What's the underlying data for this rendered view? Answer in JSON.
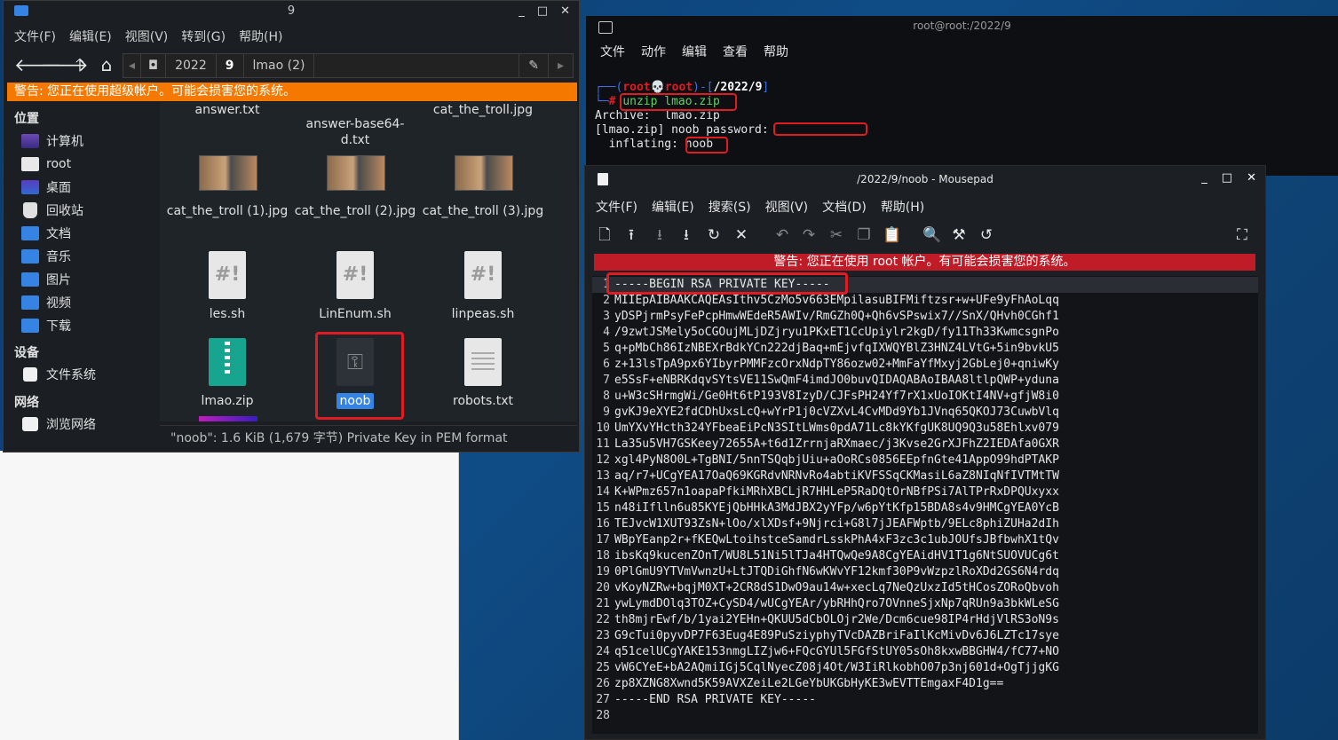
{
  "file_manager": {
    "title": "9",
    "window_controls": [
      "_",
      "□",
      "✕"
    ],
    "menu": [
      "文件(F)",
      "编辑(E)",
      "视图(V)",
      "转到(G)",
      "帮助(H)"
    ],
    "breadcrumbs": [
      "2022",
      "9",
      "lmao (2)"
    ],
    "warning": "警告: 您正在使用超级帐户。可能会损害您的系统。",
    "sidebar": {
      "places_heading": "位置",
      "places": [
        "计算机",
        "root",
        "桌面",
        "回收站",
        "文档",
        "音乐",
        "图片",
        "视频",
        "下载"
      ],
      "devices_heading": "设备",
      "devices": [
        "文件系统"
      ],
      "network_heading": "网络",
      "network": [
        "浏览网络"
      ]
    },
    "files": [
      {
        "name": "answer.txt"
      },
      {
        "name": "answer-base64-\nd.txt"
      },
      {
        "name": "cat_the_troll.jpg"
      },
      {
        "name": "cat_the_troll (1).jpg"
      },
      {
        "name": "cat_the_troll (2).jpg"
      },
      {
        "name": "cat_the_troll (3).jpg"
      },
      {
        "name": "les.sh"
      },
      {
        "name": "LinEnum.sh"
      },
      {
        "name": "linpeas.sh"
      },
      {
        "name": "lmao.zip"
      },
      {
        "name": "noob"
      },
      {
        "name": "robots.txt"
      }
    ],
    "status": "\"noob\": 1.6 KiB (1,679 字节) Private Key in PEM format"
  },
  "terminal": {
    "title": "root@root:/2022/9",
    "menu": [
      "文件",
      "动作",
      "编辑",
      "查看",
      "帮助"
    ],
    "prompt_user": "root",
    "prompt_skull": "💀",
    "prompt_host": "root",
    "prompt_path": "/2022/9",
    "command": "unzip lmao.zip",
    "lines": [
      "Archive:  lmao.zip",
      "[lmao.zip] noob password:"
    ],
    "inflating_prefix": "  inflating: ",
    "inflating_file": "noob"
  },
  "mousepad": {
    "title": "/2022/9/noob - Mousepad",
    "menu": [
      "文件(F)",
      "编辑(E)",
      "搜索(S)",
      "视图(V)",
      "文档(D)",
      "帮助(H)"
    ],
    "warning": "警告: 您正在使用 root 帐户。有可能会损害您的系统。",
    "lines": [
      "-----BEGIN RSA PRIVATE KEY-----",
      "MIIEpAIBAAKCAQEAsIthv5CzMo5v663EMpilasuBIFMiftzsr+w+UFe9yFhAoLqq",
      "yDSPjrmPsyFePcpHmwWEdeR5AWIv/RmGZh0Q+Qh6vSPswix7//SnX/QHvh0CGhf1",
      "/9zwtJSMely5oCGOujMLjDZjryu1PKxET1CcUpiylr2kgD/fy11Th33KwmcsgnPo",
      "q+pMbCh86IzNBEXrBdkYCn222djBaq+mEjvfqIXWQYBlZ3HNZ4LVtG+5in9bvkU5",
      "z+13lsTpA9px6YIbyrPMMFzcOrxNdpTY86ozw02+MmFaYfMxyj2GbLej0+qniwKy",
      "e5SsF+eNBRKdqvSYtsVE11SwQmF4imdJO0buvQIDAQABAoIBAA8ltlpQWP+yduna",
      "u+W3cSHrmgWi/Ge0Ht6tP193V8IzyD/CJFsPH24Yf7rX1xUoIOKtI4NV+gfjW8i0",
      "gvKJ9eXYE2fdCDhUxsLcQ+wYrP1j0cVZXvL4CvMDd9Yb1JVnq65QKOJ73CuwbVlq",
      "UmYXvYHcth324YFbeaEiPcN3SItLWms0pdA71Lc8kYKfgUK8UQ9Q3u58Ehlxv079",
      "La35u5VH7GSKeey72655A+t6d1ZrrnjaRXmaec/j3Kvse2GrXJFhZ2IEDAfa0GXR",
      "xgl4PyN8O0L+TgBNI/5nnTSQqbjUiu+aOoRCs0856EEpfnGte41AppO99hdPTAKP",
      "aq/r7+UCgYEA17OaQ69KGRdvNRNvRo4abtiKVFSSqCKMasiL6aZ8NIqNfIVTMtTW",
      "K+WPmz657n1oapaPfkiMRhXBCLjR7HHLeP5RaDQtOrNBfPSi7AlTPrRxDPQUxyxx",
      "n48iIflln6u85KYEjQbHHkA3MdJBX2yYFp/w6pYtKfp15BDA8s4v9HMCgYEA0YcB",
      "TEJvcW1XUT93ZsN+lOo/xlXDsf+9Njrci+G8l7jJEAFWptb/9ELc8phiZUHa2dIh",
      "WBpYEanp2r+fKEQwLtoihstceSamdrLsskPhA4xF3zc3c1ubJOUfsJBfbwhX1tQv",
      "ibsKq9kucenZOnT/WU8L51Ni5lTJa4HTQwQe9A8CgYEAidHV1T1g6NtSUOVUCg6t",
      "0PlGmU9YTVmVwnzU+LtJTQDiGhfN6wKWvYF12kmf30P9vWzpzlRoXDd2GS6N4rdq",
      "vKoyNZRw+bqjM0XT+2CR8dS1DwO9au14w+xecLq7NeQzUxzId5tHCosZORoQbvoh",
      "ywLymdDOlq3TOZ+CySD4/wUCgYEAr/ybRHhQro7OVnneSjxNp7qRUn9a3bkWLeSG",
      "th8mjrEwf/b/1yai2YEHn+QKUU5dCbOLOjr2We/Dcm6cue98IP4rHdjVlRS3oN9s",
      "G9cTui0pyvDP7F63Eug4E89PuSziyphyTVcDAZBriFaIlKcMivDv6J6LZTc17sye",
      "q51celUCgYAKE153nmgLIZjw6+FQcGYUl5FGfStUY05sOh8kxwBBGHW4/fC77+NO",
      "vW6CYeE+bA2AQmiIGj5CqlNyecZ08j4Ot/W3IiRlkobhO07p3nj601d+OgTjjgKG",
      "zp8XZNG8Xwnd5K59AVXZeiLe2LGeYbUKGbHyKE3wEVTTEmgaxF4D1g==",
      "-----END RSA PRIVATE KEY-----",
      ""
    ]
  },
  "colors": {
    "warning_orange": "#f57900",
    "warning_red": "#c01c28",
    "highlight_box": "#e01b24",
    "selection_blue": "#3584e4"
  }
}
